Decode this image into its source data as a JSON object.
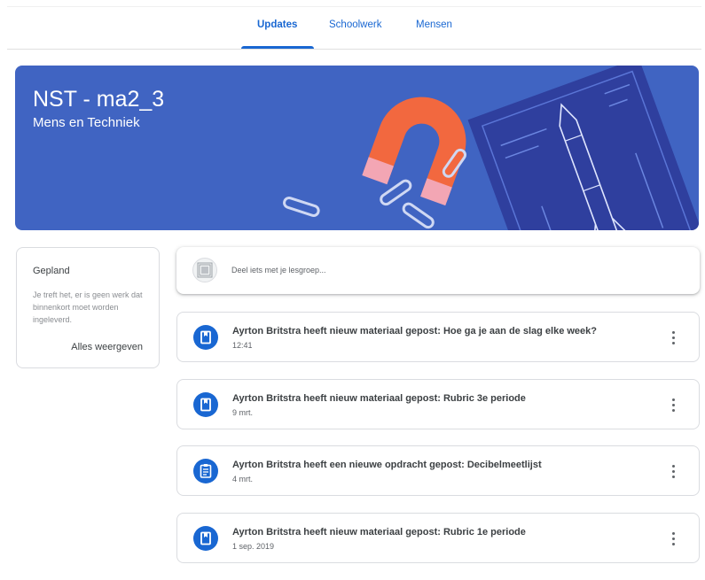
{
  "tabs": [
    {
      "label": "Updates",
      "active": true
    },
    {
      "label": "Schoolwerk",
      "active": false
    },
    {
      "label": "Mensen",
      "active": false
    }
  ],
  "banner": {
    "title": "NST - ma2_3",
    "subtitle": "Mens en Techniek",
    "color": "#4064c2"
  },
  "upcoming": {
    "title": "Gepland",
    "text": "Je treft het, er is geen werk dat binnenkort moet worden ingeleverd.",
    "link": "Alles weergeven"
  },
  "share": {
    "placeholder": "Deel iets met je lesgroep..."
  },
  "stream": [
    {
      "icon": "material-icon",
      "title": "Ayrton Britstra heeft nieuw materiaal gepost: Hoe ga je aan de slag elke week?",
      "date": "12:41"
    },
    {
      "icon": "material-icon",
      "title": "Ayrton Britstra heeft nieuw materiaal gepost: Rubric 3e periode",
      "date": "9 mrt."
    },
    {
      "icon": "assignment-icon",
      "title": "Ayrton Britstra heeft een nieuwe opdracht gepost: Decibelmeetlijst",
      "date": "4 mrt."
    },
    {
      "icon": "material-icon",
      "title": "Ayrton Britstra heeft nieuw materiaal gepost: Rubric 1e periode",
      "date": "1 sep. 2019"
    }
  ],
  "colors": {
    "accent": "#1967d2",
    "text": "#3c4043",
    "muted": "#5f6368",
    "border": "#dadce0"
  }
}
